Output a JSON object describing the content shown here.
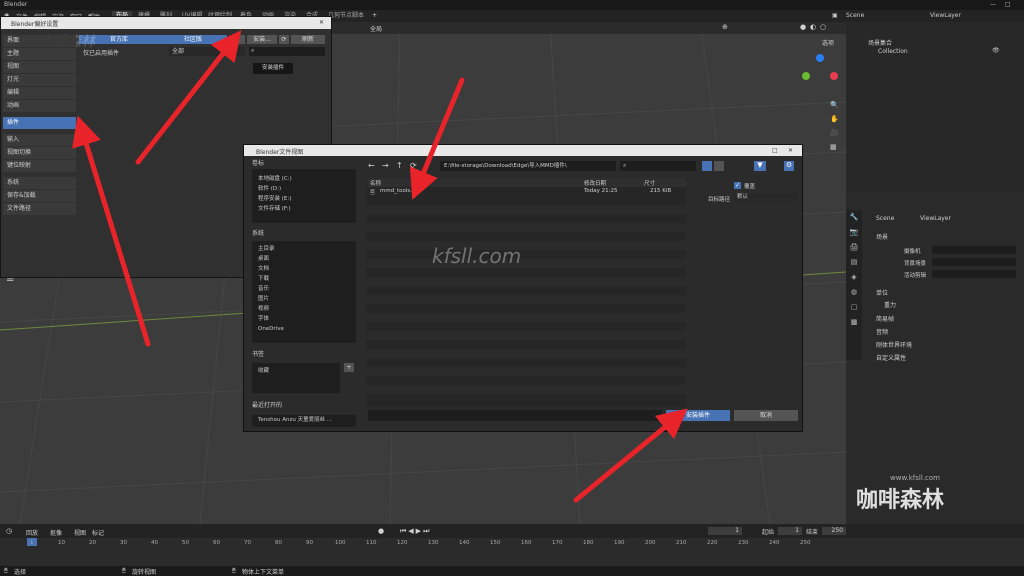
{
  "app": {
    "name": "Blender"
  },
  "topbar": {
    "title": "Blender",
    "menus": [
      "文件",
      "编辑",
      "渲染",
      "窗口",
      "帮助"
    ],
    "workspaces": [
      "布局",
      "建模",
      "雕刻",
      "UV编辑",
      "纹理绘制",
      "着色",
      "动画",
      "渲染",
      "合成",
      "几何节点",
      "脚本"
    ],
    "scene": "Scene",
    "view_layer": "ViewLayer"
  },
  "viewport": {
    "mode": "全局",
    "options_label": "选项"
  },
  "outliner": {
    "root": "场景集合",
    "collection": "Collection"
  },
  "properties": {
    "breadcrumb_scene": "Scene",
    "breadcrumb_layer": "ViewLayer",
    "section_scene": "场景",
    "camera_label": "摄像机",
    "bg_scene_label": "背景场景",
    "active_clip_label": "活动剪辑",
    "sections": [
      "单位",
      "重力",
      "简易帧",
      "音频",
      "刚体世界环境",
      "自定义属性"
    ]
  },
  "prefs": {
    "title": "Blender偏好设置",
    "tab_official": "官方库",
    "tab_community": "社区版",
    "install_btn": "安装...",
    "refresh_btn": "刷新",
    "filter_label": "仅已启用插件",
    "category_value": "全部",
    "tooltip": "安装插件",
    "nav": [
      "界面",
      "主题",
      "视图",
      "灯光",
      "编辑",
      "动画",
      "插件",
      "输入",
      "视图切换",
      "键位映射",
      "系统",
      "保存&加载",
      "文件路径"
    ]
  },
  "filedlg": {
    "title": "Blender文件视图",
    "volumes_label": "卷标",
    "volumes": [
      "本地磁盘 (C:)",
      "软件 (D:)",
      "程序安装 (E:)",
      "文件存储 (F:)"
    ],
    "system_label": "系统",
    "system": [
      "主目录",
      "桌面",
      "文档",
      "下载",
      "音乐",
      "图片",
      "视频",
      "字体",
      "OneDrive"
    ],
    "bookmarks_label": "书签",
    "bookmarks": [
      "收藏"
    ],
    "recent_label": "最近打开的",
    "recent": [
      "Tenshou Anzu 天童爱丽丝 ..."
    ],
    "path": "E:\\file-storage\\Download\\Edge\\导入MMD插件\\",
    "col_name": "名称",
    "col_date": "修改日期",
    "col_size": "尺寸",
    "file_name": "mmd_tools.zip",
    "file_date": "Today 21:25",
    "file_size": "215 KiB",
    "overwrite_label": "覆盖",
    "target_label": "目标路径",
    "target_value": "默认",
    "install_btn": "安装插件",
    "cancel_btn": "取消"
  },
  "timeline": {
    "menus": [
      "回放",
      "抠像",
      "视图",
      "标记"
    ],
    "current_frame": "1",
    "start_label": "起始",
    "start": "1",
    "end_label": "结束",
    "end": "250",
    "ticks": [
      "1",
      "10",
      "20",
      "30",
      "40",
      "50",
      "60",
      "70",
      "80",
      "90",
      "100",
      "110",
      "120",
      "130",
      "140",
      "150",
      "160",
      "170",
      "180",
      "190",
      "200",
      "210",
      "220",
      "230",
      "240",
      "250"
    ]
  },
  "status": {
    "select": "选择",
    "rotate": "旋转视图",
    "context": "物体上下文菜单"
  },
  "watermark": {
    "center": "kfsll.com",
    "logo": "咖啡森林",
    "logo_url": "www.kfsll.com",
    "top_left": "咖啡森林"
  },
  "colors": {
    "accent": "#4772b3",
    "arrow": "#e8242a"
  }
}
